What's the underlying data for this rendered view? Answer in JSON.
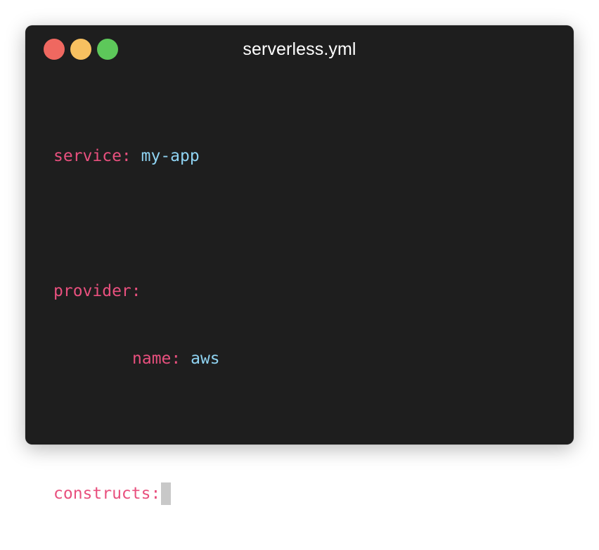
{
  "colors": {
    "window_bg": "#1e1e1e",
    "title_text": "#ffffff",
    "key": "#e8507e",
    "value": "#8fd3f2",
    "cursor": "#c8c8c8",
    "close": "#ef6860",
    "minimize": "#f7c060",
    "zoom": "#5dc85a"
  },
  "window": {
    "title": "serverless.yml"
  },
  "editor": {
    "lines": [
      {
        "key": "service:",
        "value": "my-app"
      },
      {
        "key": "provider:"
      },
      {
        "key": "name:",
        "value": "aws"
      },
      {
        "key": "constructs:"
      }
    ]
  }
}
